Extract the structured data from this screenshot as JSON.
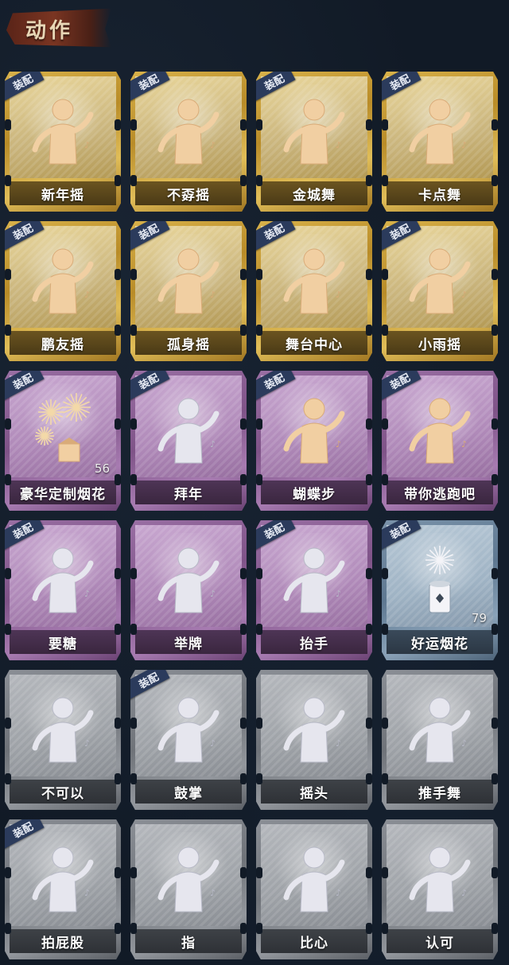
{
  "header": {
    "title": "动作"
  },
  "equip_label": "装配",
  "cards": [
    {
      "label": "新年摇",
      "tier": "gold",
      "equipped": true,
      "icon": "dancer-clap-icon",
      "figure": "tan"
    },
    {
      "label": "不孬摇",
      "tier": "gold",
      "equipped": true,
      "icon": "dancer-arm-up-icon",
      "figure": "tan"
    },
    {
      "label": "金城舞",
      "tier": "gold",
      "equipped": true,
      "icon": "dancer-wave-icon",
      "figure": "tan"
    },
    {
      "label": "卡点舞",
      "tier": "gold",
      "equipped": true,
      "icon": "dancer-point-up-icon",
      "figure": "tan"
    },
    {
      "label": "鹏友摇",
      "tier": "gold",
      "equipped": true,
      "icon": "dancer-cross-arms-icon",
      "figure": "tan"
    },
    {
      "label": "孤身摇",
      "tier": "gold",
      "equipped": true,
      "icon": "dancer-sway-icon",
      "figure": "tan"
    },
    {
      "label": "舞台中心",
      "tier": "gold",
      "equipped": true,
      "icon": "dancer-pose-icon",
      "figure": "tan"
    },
    {
      "label": "小雨摇",
      "tier": "gold",
      "equipped": true,
      "icon": "dancer-arm-cross-icon",
      "figure": "tan"
    },
    {
      "label": "豪华定制烟花",
      "tier": "purple",
      "equipped": true,
      "icon": "fireworks-box-icon",
      "figure": "fireworks",
      "count": "56"
    },
    {
      "label": "拜年",
      "tier": "purple",
      "equipped": true,
      "icon": "bow-greeting-icon",
      "figure": "silver"
    },
    {
      "label": "蝴蝶步",
      "tier": "purple",
      "equipped": true,
      "icon": "dancer-dab-icon",
      "figure": "tan"
    },
    {
      "label": "带你逃跑吧",
      "tier": "purple",
      "equipped": true,
      "icon": "dancer-reach-icon",
      "figure": "tan"
    },
    {
      "label": "要糖",
      "tier": "purple",
      "equipped": true,
      "icon": "hand-out-icon",
      "figure": "silver"
    },
    {
      "label": "举牌",
      "tier": "purple",
      "equipped": false,
      "icon": "hold-sign-icon",
      "figure": "silver"
    },
    {
      "label": "抬手",
      "tier": "purple",
      "equipped": true,
      "icon": "raise-hand-icon",
      "figure": "silver"
    },
    {
      "label": "好运烟花",
      "tier": "blue",
      "equipped": true,
      "icon": "firework-tube-icon",
      "figure": "tube",
      "count": "79"
    },
    {
      "label": "不可以",
      "tier": "grey",
      "equipped": false,
      "icon": "finger-wag-icon",
      "figure": "silver"
    },
    {
      "label": "鼓掌",
      "tier": "grey",
      "equipped": true,
      "icon": "clap-hands-icon",
      "figure": "silver"
    },
    {
      "label": "摇头",
      "tier": "grey",
      "equipped": false,
      "icon": "shake-head-icon",
      "figure": "silver"
    },
    {
      "label": "推手舞",
      "tier": "grey",
      "equipped": false,
      "icon": "push-dance-icon",
      "figure": "silver"
    },
    {
      "label": "拍屁股",
      "tier": "grey",
      "equipped": true,
      "icon": "pat-butt-icon",
      "figure": "silver"
    },
    {
      "label": "指",
      "tier": "grey",
      "equipped": false,
      "icon": "point-hand-icon",
      "figure": "silver"
    },
    {
      "label": "比心",
      "tier": "grey",
      "equipped": false,
      "icon": "finger-heart-icon",
      "figure": "silver"
    },
    {
      "label": "认可",
      "tier": "grey",
      "equipped": false,
      "icon": "thumbs-up-icon",
      "figure": "silver"
    }
  ]
}
